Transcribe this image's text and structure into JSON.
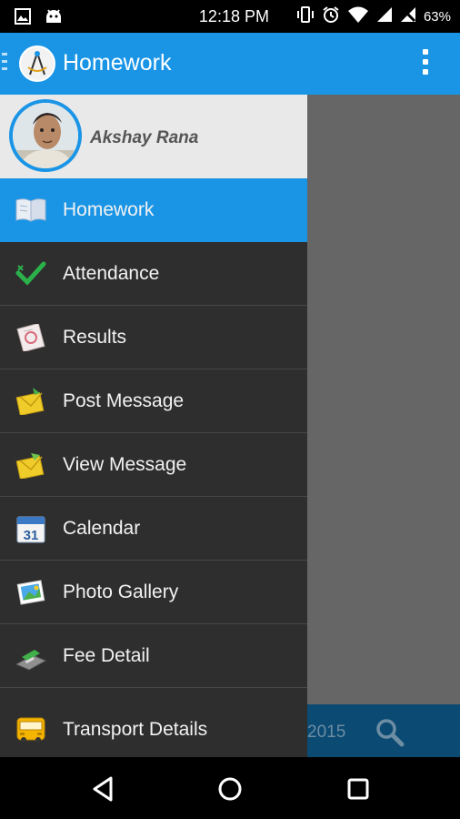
{
  "status_bar": {
    "time": "12:18 PM",
    "battery": "63%",
    "left_icons": [
      "image-icon",
      "android-icon"
    ],
    "right_icons": [
      "vibrate-icon",
      "alarm-icon",
      "wifi-icon",
      "signal-icon",
      "no-signal-icon"
    ]
  },
  "action_bar": {
    "title": "Homework",
    "color": "#1a95e6",
    "logo_icon": "compass-logo-icon",
    "overflow_icon": "more-vert-icon"
  },
  "profile": {
    "name": "Akshay Rana",
    "avatar_icon": "person-avatar"
  },
  "menu": {
    "items": [
      {
        "label": "Homework",
        "icon": "book-icon",
        "active": true
      },
      {
        "label": "Attendance",
        "icon": "checkmark-icon"
      },
      {
        "label": "Results",
        "icon": "report-card-icon"
      },
      {
        "label": "Post Message",
        "icon": "envelope-icon"
      },
      {
        "label": "View Message",
        "icon": "envelope-open-icon"
      },
      {
        "label": "Calendar",
        "icon": "calendar-icon"
      },
      {
        "label": "Photo Gallery",
        "icon": "photo-icon"
      },
      {
        "label": "Fee Detail",
        "icon": "card-swipe-icon"
      },
      {
        "label": "Transport Details",
        "icon": "bus-icon"
      }
    ]
  },
  "background_content": {
    "year_fragment": "2015",
    "search_icon": "search-icon"
  },
  "calendar_icon_day": "31",
  "nav_bar": {
    "icons": [
      "back-icon",
      "home-icon",
      "recents-icon"
    ]
  }
}
